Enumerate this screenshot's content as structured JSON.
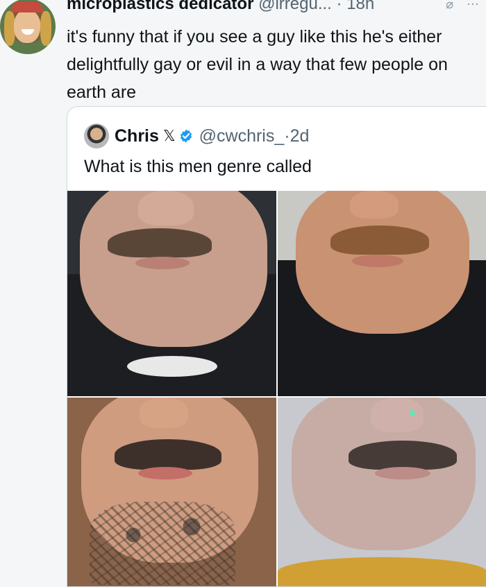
{
  "tweet": {
    "author_name": "microplastics dedicator",
    "handle": "@irregu...",
    "time_sep": "·",
    "time": "18h",
    "text": "it's funny that if you see a guy like this he's either delightfully gay or evil in a way that few people on earth are"
  },
  "icons": {
    "main_avatar": "avatar",
    "top_right_1": "link-icon",
    "top_right_2": "more-icon",
    "quote_avatar": "avatar",
    "x_logo": "x-icon",
    "verified": "verified-icon"
  },
  "quote": {
    "name": "Chris",
    "handle": "@cwchris_",
    "time_sep": "·",
    "time": "2d",
    "text": "What is this men genre called"
  },
  "photos": {
    "count": 4
  },
  "colors": {
    "background": "#f4f6f7",
    "text": "#0f1419",
    "muted": "#536471",
    "verified": "#1d9bf0",
    "border": "#cfd9de"
  }
}
